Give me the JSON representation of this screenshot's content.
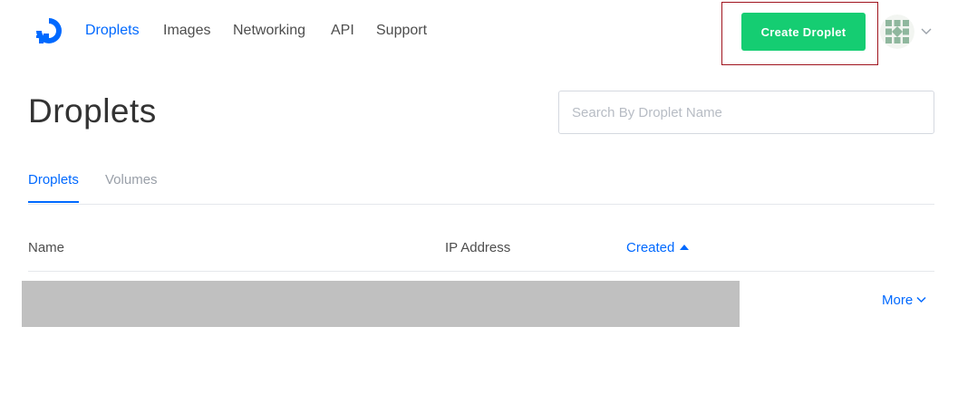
{
  "nav": {
    "items": [
      {
        "label": "Droplets",
        "active": true
      },
      {
        "label": "Images",
        "active": false
      },
      {
        "label": "Networking",
        "active": false
      },
      {
        "label": "API",
        "active": false
      },
      {
        "label": "Support",
        "active": false
      }
    ],
    "create_button_label": "Create Droplet",
    "logo_icon": "digitalocean-logo-icon",
    "avatar_icon": "identicon-avatar-icon",
    "colors": {
      "accent": "#0069ff",
      "create_button": "#15cd72",
      "highlight_border": "#a0141e"
    }
  },
  "page": {
    "title": "Droplets",
    "search_placeholder": "Search By Droplet Name"
  },
  "tabs": [
    {
      "label": "Droplets",
      "active": true
    },
    {
      "label": "Volumes",
      "active": false
    }
  ],
  "table": {
    "columns": [
      {
        "label": "Name",
        "sorted": false
      },
      {
        "label": "IP Address",
        "sorted": false
      },
      {
        "label": "Created",
        "sorted": true,
        "sort_direction": "ascending"
      }
    ],
    "row_redacted": true,
    "more_label": "More"
  }
}
